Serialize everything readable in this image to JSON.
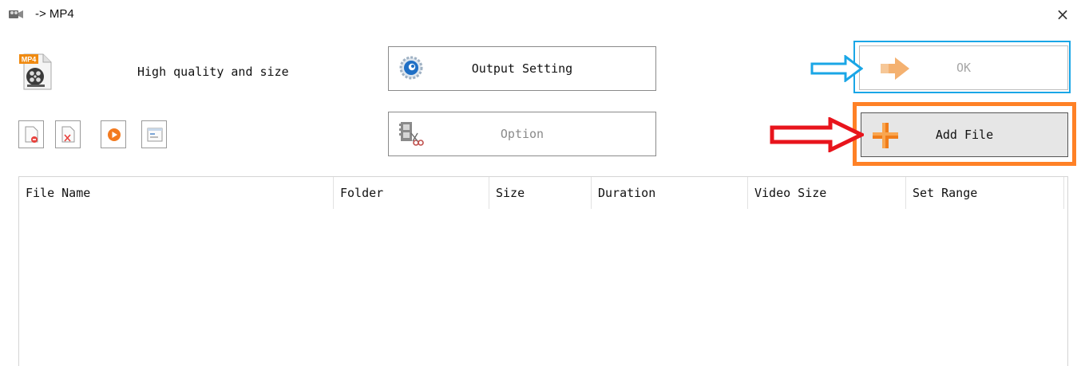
{
  "window": {
    "title": "-> MP4",
    "icons": {
      "app": "film-camera-icon",
      "close": "close-icon"
    },
    "close_glyph": "×"
  },
  "profile": {
    "icon": "mp4-file-icon",
    "badge": "MP4",
    "label": "High quality and size"
  },
  "toolbar": {
    "items": [
      {
        "name": "remove-file",
        "icon": "remove-file-icon"
      },
      {
        "name": "clear-list",
        "icon": "clear-list-icon"
      },
      {
        "name": "play",
        "icon": "play-icon"
      },
      {
        "name": "properties",
        "icon": "properties-icon"
      }
    ]
  },
  "buttons": {
    "output_setting": {
      "label": "Output Setting",
      "icon": "settings-icon",
      "enabled": true
    },
    "option": {
      "label": "Option",
      "icon": "film-scissors-icon",
      "enabled": false
    },
    "ok": {
      "label": "OK",
      "icon": "arrow-right-icon",
      "enabled": false
    },
    "add_file": {
      "label": "Add File",
      "icon": "plus-icon",
      "enabled": true
    }
  },
  "annotations": {
    "ok_highlight_color": "#1aa6e6",
    "add_file_highlight_color": "#ff8126",
    "blue_arrow_color": "#1aa6e6",
    "red_arrow_color": "#e8141c"
  },
  "file_table": {
    "columns": [
      "File Name",
      "Folder",
      "Size",
      "Duration",
      "Video Size",
      "Set Range"
    ],
    "rows": []
  }
}
